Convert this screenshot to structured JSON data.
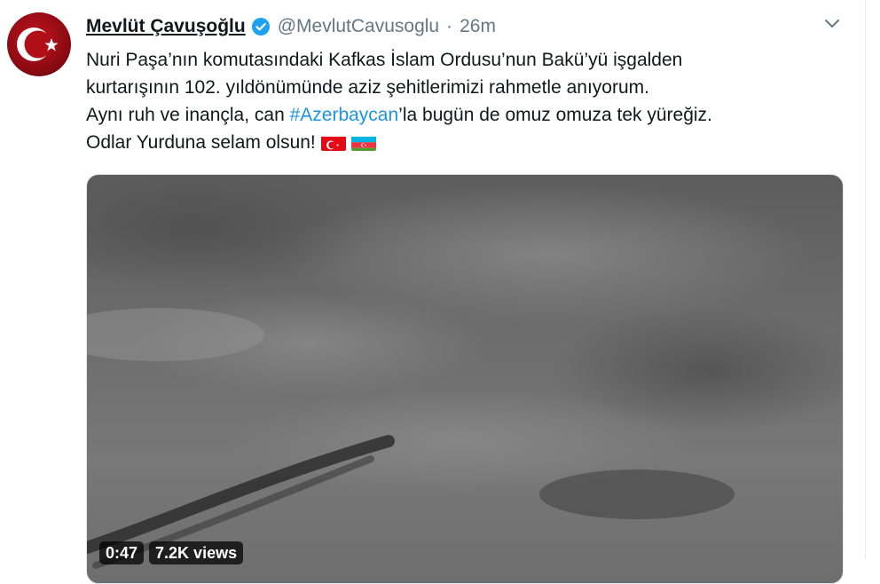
{
  "tweet": {
    "author_name": "Mevlüt Çavuşoğlu",
    "handle": "@MevlutCavusoglu",
    "separator": "·",
    "time": "26m",
    "text": {
      "line1": "Nuri Paşa’nın komutasındaki Kafkas İslam Ordusu’nun Bakü’yü işgalden",
      "line2": "kurtarışının 102. yıldönümünde aziz şehitlerimizi rahmetle anıyorum.",
      "line3_before": "Aynı ruh ve inançla, can ",
      "hashtag": "#Azerbaycan",
      "line3_after": "’la bugün de omuz omuza tek yüreğiz.",
      "line4": "Odlar Yurduna selam olsun! "
    },
    "flags": [
      "turkey-flag-icon",
      "azerbaijan-flag-icon"
    ],
    "video": {
      "duration": "0:47",
      "views": "7.2K views"
    }
  },
  "colors": {
    "hashtag": "#1b95e0",
    "verified": "#1da1f2",
    "muted": "#657786"
  }
}
